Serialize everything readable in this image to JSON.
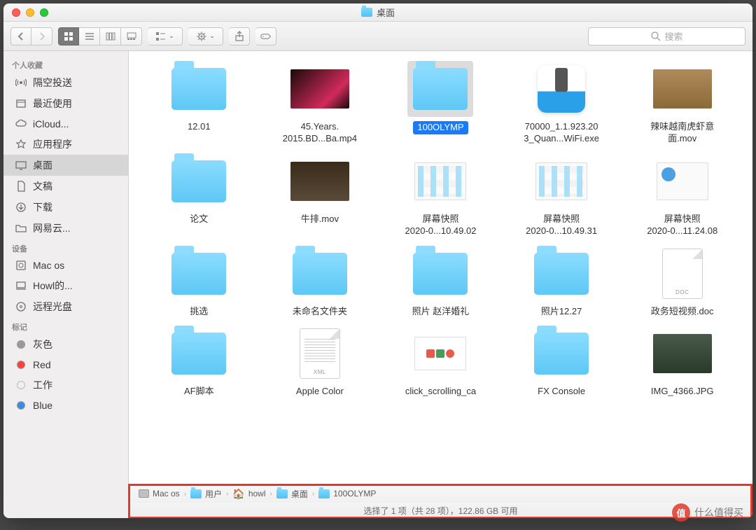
{
  "window_title": "桌面",
  "search_placeholder": "搜索",
  "sidebar": {
    "sections": [
      {
        "header": "个人收藏",
        "items": [
          {
            "icon": "airdrop",
            "label": "隔空投送"
          },
          {
            "icon": "recents",
            "label": "最近使用"
          },
          {
            "icon": "icloud",
            "label": "iCloud..."
          },
          {
            "icon": "apps",
            "label": "应用程序"
          },
          {
            "icon": "desktop",
            "label": "桌面",
            "selected": true
          },
          {
            "icon": "documents",
            "label": "文稿"
          },
          {
            "icon": "downloads",
            "label": "下载"
          },
          {
            "icon": "folder",
            "label": "网易云..."
          }
        ]
      },
      {
        "header": "设备",
        "items": [
          {
            "icon": "hdd",
            "label": "Mac os"
          },
          {
            "icon": "laptop",
            "label": "Howl的..."
          },
          {
            "icon": "disc",
            "label": "远程光盘"
          }
        ]
      },
      {
        "header": "标记",
        "items": [
          {
            "icon": "tag",
            "color": "#9a9a9a",
            "label": "灰色"
          },
          {
            "icon": "tag",
            "color": "#ff4136",
            "label": "Red"
          },
          {
            "icon": "tag",
            "color": "transparent",
            "label": "工作"
          },
          {
            "icon": "tag",
            "color": "#3a8ae8",
            "label": "Blue"
          }
        ]
      }
    ]
  },
  "items": [
    {
      "type": "folder",
      "l1": "12.01",
      "l2": ""
    },
    {
      "type": "video1",
      "l1": "45.Years.",
      "l2": "2015.BD...Ba.mp4"
    },
    {
      "type": "folder",
      "l1": "100OLYMP",
      "l2": "",
      "selected": true
    },
    {
      "type": "app",
      "l1": "70000_1.1.923.20",
      "l2": "3_Quan...WiFi.exe"
    },
    {
      "type": "video2",
      "l1": "辣味越南虎虾意",
      "l2": "面.mov"
    },
    {
      "type": "folder",
      "l1": "论文",
      "l2": ""
    },
    {
      "type": "video3",
      "l1": "牛排.mov",
      "l2": ""
    },
    {
      "type": "shot1",
      "l1": "屏幕快照",
      "l2": "2020-0...10.49.02"
    },
    {
      "type": "shot2",
      "l1": "屏幕快照",
      "l2": "2020-0...10.49.31"
    },
    {
      "type": "shot3",
      "l1": "屏幕快照",
      "l2": "2020-0...11.24.08"
    },
    {
      "type": "folder",
      "l1": "挑选",
      "l2": ""
    },
    {
      "type": "folder",
      "l1": "未命名文件夹",
      "l2": ""
    },
    {
      "type": "folder",
      "l1": "照片 赵洋婚礼",
      "l2": ""
    },
    {
      "type": "folder",
      "l1": "照片12.27",
      "l2": ""
    },
    {
      "type": "doc",
      "l1": "政务短视频.doc",
      "l2": ""
    },
    {
      "type": "folder",
      "l1": "AF脚本",
      "l2": ""
    },
    {
      "type": "xml",
      "l1": "Apple Color",
      "l2": ""
    },
    {
      "type": "web",
      "l1": "click_scrolling_ca",
      "l2": ""
    },
    {
      "type": "folder",
      "l1": "FX Console",
      "l2": ""
    },
    {
      "type": "photo",
      "l1": "IMG_4366.JPG",
      "l2": ""
    }
  ],
  "path": [
    {
      "icon": "drive",
      "label": "Mac os"
    },
    {
      "icon": "folder",
      "label": "用户"
    },
    {
      "icon": "home",
      "label": "howl"
    },
    {
      "icon": "folder",
      "label": "桌面"
    },
    {
      "icon": "folder",
      "label": "100OLYMP"
    }
  ],
  "status": "选择了 1 项（共 28 项），122.86 GB 可用",
  "watermark": {
    "badge": "值",
    "text": "什么值得买"
  }
}
